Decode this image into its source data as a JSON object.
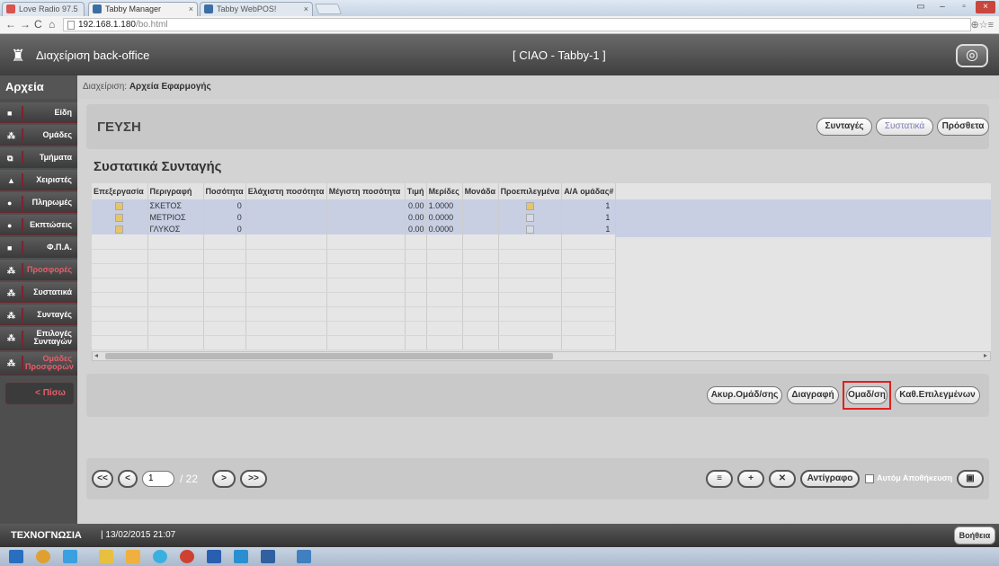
{
  "browser": {
    "tabs": [
      {
        "label": "Love Radio 97.5",
        "close": "◂ ×",
        "color": "#d9534f"
      },
      {
        "label": "Tabby Manager",
        "close": "×",
        "color": "#3b6ea5"
      },
      {
        "label": "Tabby WebPOS!",
        "close": "×",
        "color": "#3b6ea5"
      }
    ],
    "url_host": "192.168.1.180",
    "url_path": "/bo.html",
    "window_buttons": [
      "▭",
      "–",
      "▫",
      "×"
    ]
  },
  "header": {
    "title": "Διαχείριση back-office",
    "center": "[ CIAO - Tabby-1 ]",
    "power_icon": "◎"
  },
  "sidebar": {
    "heading": "Αρχεία",
    "items": [
      {
        "label": "Είδη",
        "icon": "■"
      },
      {
        "label": "Ομάδες",
        "icon": "⁂"
      },
      {
        "label": "Τμήματα",
        "icon": "⧉"
      },
      {
        "label": "Χειριστές",
        "icon": "▲"
      },
      {
        "label": "Πληρωμές",
        "icon": "●"
      },
      {
        "label": "Εκπτώσεις",
        "icon": "●"
      },
      {
        "label": "Φ.Π.Α.",
        "icon": "■"
      },
      {
        "label": "Προσφορές",
        "icon": "⁂",
        "red": true
      },
      {
        "label": "Συστατικά",
        "icon": "⁂"
      },
      {
        "label": "Συνταγές",
        "icon": "⁂"
      },
      {
        "label": "Επιλογές Συνταγών",
        "icon": "⁂"
      },
      {
        "label": "Ομάδες Προσφορών",
        "icon": "⁂",
        "red": true
      }
    ],
    "back": "< Πίσω"
  },
  "breadcrumb": {
    "prefix": "Διαχείριση:",
    "current": "Αρχεία Εφαρμογής"
  },
  "panel": {
    "title": "ΓΕΥΣΗ",
    "tabs": [
      "Συνταγές",
      "Συστατικά",
      "Πρόσθετα"
    ]
  },
  "section_title": "Συστατικά Συνταγής",
  "table": {
    "columns": [
      "Επεξεργασία",
      "Περιγραφή",
      "Ποσότητα",
      "Ελάχιστη ποσότητα",
      "Μέγιστη ποσότητα",
      "Τιμή",
      "Μερίδες",
      "Μονάδα",
      "Προεπιλεγμένα",
      "Α/Α ομάδας#"
    ],
    "rows": [
      {
        "edit": true,
        "description": "ΣΚΕΤΟΣ",
        "quantity": "0",
        "min": "",
        "max": "",
        "price": "0.00",
        "portions": "1.0000",
        "unit": "",
        "default": true,
        "group": "1"
      },
      {
        "edit": true,
        "description": "ΜΕΤΡΙΟΣ",
        "quantity": "0",
        "min": "",
        "max": "",
        "price": "0.00",
        "portions": "0.0000",
        "unit": "",
        "default": false,
        "group": "1"
      },
      {
        "edit": true,
        "description": "ΓΛΥΚΟΣ",
        "quantity": "0",
        "min": "",
        "max": "",
        "price": "0.00",
        "portions": "0.0000",
        "unit": "",
        "default": false,
        "group": "1"
      }
    ],
    "empty_rows": 8,
    "scroll_left": "◂",
    "scroll_right": "▸"
  },
  "actions": [
    "Ακυρ.Ομάδ/σης",
    "Διαγραφή",
    "Ομαδ/ση",
    "Καθ.Επιλεγμένων"
  ],
  "pager": {
    "first": "<<",
    "prev": "<",
    "current": "1",
    "total": "/ 22",
    "next": ">",
    "last": ">>"
  },
  "bottom_tools": {
    "list_icon": "≡",
    "add_icon": "+",
    "delete_icon": "✕",
    "copy": "Αντίγραφο",
    "autosave": "Αυτόμ Αποθήκευση",
    "save_icon": "💾"
  },
  "status": {
    "brand": "ΤΕΧΝΟΓΝΩΣΙΑ",
    "datetime": "| 13/02/2015 21:07",
    "help": "Βοήθεια"
  },
  "taskbar_colors": [
    "#2a6fbf",
    "#e0a030",
    "#3aa0e0",
    "#e8c040",
    "#f0b040",
    "#3ab0e0",
    "#d04030",
    "#2a5fb0",
    "#2a8fd0",
    "#3060a0",
    "#4080c0"
  ]
}
